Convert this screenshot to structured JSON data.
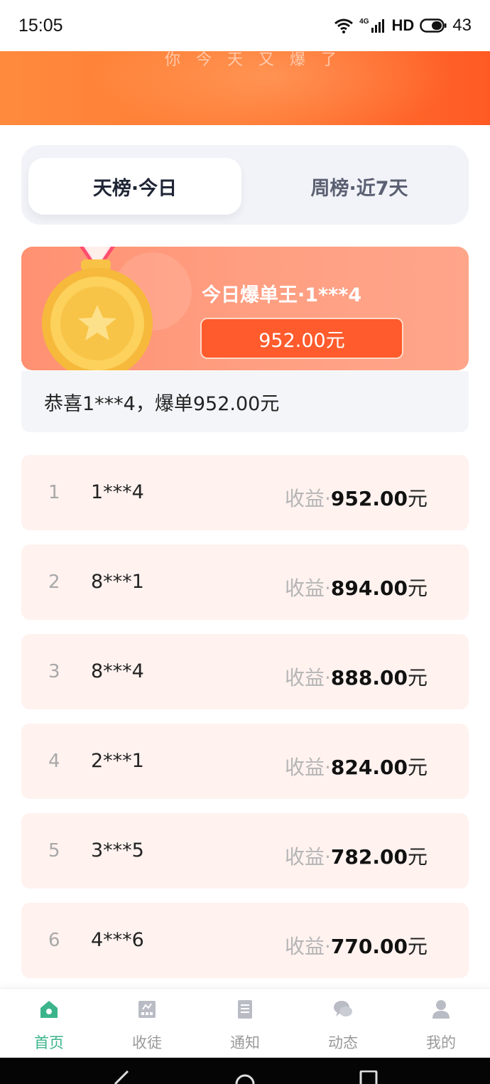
{
  "status_bar": {
    "time": "15:05",
    "network": "4G",
    "hd": "HD",
    "battery": "43"
  },
  "banner": {
    "faded_text": "你今天又爆了"
  },
  "tabs": [
    {
      "label": "天榜·今日",
      "active": true
    },
    {
      "label": "周榜·近7天",
      "active": false
    }
  ],
  "champion": {
    "title": "今日爆单王·1***4",
    "amount": "952.00元"
  },
  "congrats": "恭喜1***4，爆单952.00元",
  "ranking": [
    {
      "rank": "1",
      "user": "1***4",
      "earn_label": "收益·",
      "amount": "952.00",
      "unit": "元"
    },
    {
      "rank": "2",
      "user": "8***1",
      "earn_label": "收益·",
      "amount": "894.00",
      "unit": "元"
    },
    {
      "rank": "3",
      "user": "8***4",
      "earn_label": "收益·",
      "amount": "888.00",
      "unit": "元"
    },
    {
      "rank": "4",
      "user": "2***1",
      "earn_label": "收益·",
      "amount": "824.00",
      "unit": "元"
    },
    {
      "rank": "5",
      "user": "3***5",
      "earn_label": "收益·",
      "amount": "782.00",
      "unit": "元"
    },
    {
      "rank": "6",
      "user": "4***6",
      "earn_label": "收益·",
      "amount": "770.00",
      "unit": "元"
    }
  ],
  "bottom_nav": [
    {
      "label": "首页",
      "icon": "home-icon",
      "active": true
    },
    {
      "label": "收徒",
      "icon": "recruit-icon",
      "active": false
    },
    {
      "label": "通知",
      "icon": "notice-icon",
      "active": false
    },
    {
      "label": "动态",
      "icon": "chat-icon",
      "active": false
    },
    {
      "label": "我的",
      "icon": "user-icon",
      "active": false
    }
  ],
  "colors": {
    "brand_orange": "#ff5b2c",
    "accent_green": "#3bb48c",
    "row_bg": "#fff2ef"
  }
}
